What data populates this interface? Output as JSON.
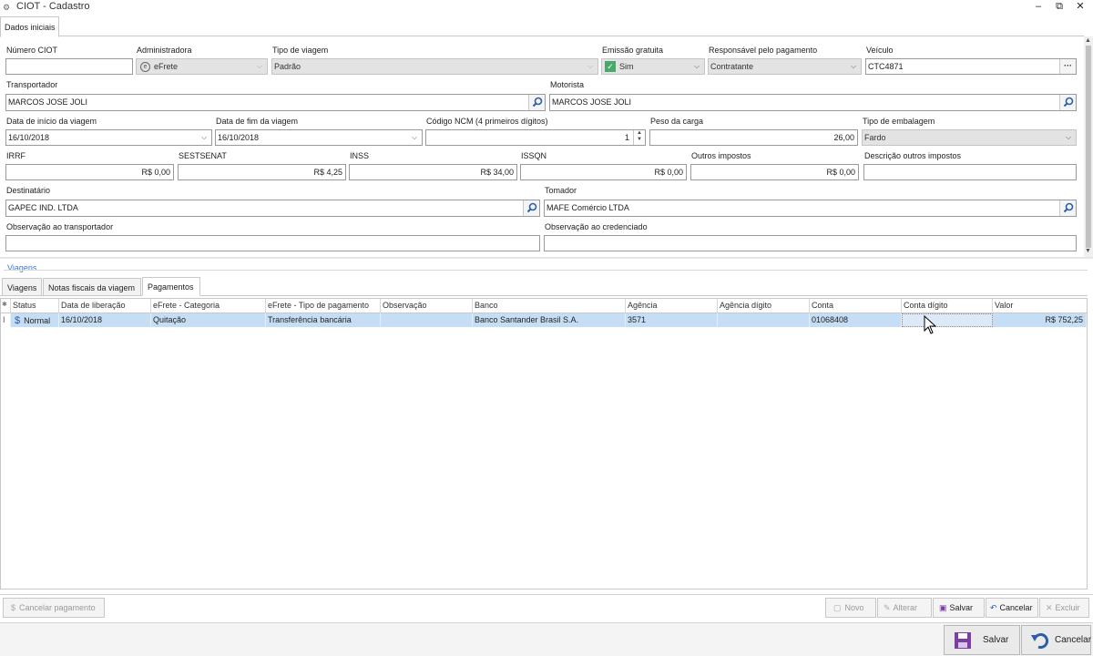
{
  "window": {
    "title": "CIOT - Cadastro",
    "minimize": "‒",
    "restore": "⧉",
    "close": "✕"
  },
  "tabs": {
    "main": "Dados iniciais"
  },
  "form": {
    "numero_ciot": {
      "label": "Número CIOT",
      "value": ""
    },
    "administradora": {
      "label": "Administradora",
      "value": "eFrete"
    },
    "tipo_viagem": {
      "label": "Tipo de viagem",
      "value": "Padrão"
    },
    "emissao_gratuita": {
      "label": "Emissão gratuita",
      "value": "Sim"
    },
    "responsavel": {
      "label": "Responsável pelo pagamento",
      "value": "Contratante"
    },
    "veiculo": {
      "label": "Veículo",
      "value": "CTC4871",
      "btn": "···"
    },
    "transportador": {
      "label": "Transportador",
      "value": "MARCOS JOSE JOLI"
    },
    "motorista": {
      "label": "Motorista",
      "value": "MARCOS JOSE JOLI"
    },
    "data_inicio": {
      "label": "Data de início da viagem",
      "value": "16/10/2018"
    },
    "data_fim": {
      "label": "Data de fim da viagem",
      "value": "16/10/2018"
    },
    "ncm": {
      "label": "Código NCM (4 primeiros dígitos)",
      "value": "1"
    },
    "peso": {
      "label": "Peso da carga",
      "value": "26,00"
    },
    "embalagem": {
      "label": "Tipo de embalagem",
      "value": "Fardo"
    },
    "irrf": {
      "label": "IRRF",
      "value": "R$ 0,00"
    },
    "sestsenat": {
      "label": "SESTSENAT",
      "value": "R$ 4,25"
    },
    "inss": {
      "label": "INSS",
      "value": "R$ 34,00"
    },
    "issqn": {
      "label": "ISSQN",
      "value": "R$ 0,00"
    },
    "outros": {
      "label": "Outros impostos",
      "value": "R$ 0,00"
    },
    "desc_outros": {
      "label": "Descrição outros impostos",
      "value": ""
    },
    "destinatario": {
      "label": "Destinatário",
      "value": "GAPEC IND. LTDA"
    },
    "tomador": {
      "label": "Tomador",
      "value": "MAFE Comércio LTDA"
    },
    "obs_transportador": {
      "label": "Observação ao transportador",
      "value": ""
    },
    "obs_credenciado": {
      "label": "Observação ao credenciado",
      "value": ""
    }
  },
  "viagens": {
    "group_title": "Viagens",
    "tabs": [
      "Viagens",
      "Notas fiscais da viagem",
      "Pagamentos"
    ],
    "columns": [
      "Status",
      "Data de liberação",
      "eFrete - Categoria",
      "eFrete - Tipo de pagamento",
      "Observação",
      "Banco",
      "Agência",
      "Agência dígito",
      "Conta",
      "Conta dígito",
      "Valor"
    ],
    "row_marker": "I",
    "rows": [
      {
        "status_icon": "$",
        "status": "Normal",
        "data": "16/10/2018",
        "categoria": "Quitação",
        "tipo": "Transferência bancária",
        "obs": "",
        "banco": "Banco Santander Brasil S.A.",
        "agencia": "3571",
        "ag_digito": "",
        "conta": "01068408",
        "conta_digito": "",
        "valor": "R$ 752,25"
      }
    ]
  },
  "toolbar": {
    "cancelar_pagamento": "Cancelar pagamento",
    "novo": "Novo",
    "alterar": "Alterar",
    "salvar": "Salvar",
    "cancelar": "Cancelar",
    "excluir": "Excluir"
  },
  "footer": {
    "salvar": "Salvar",
    "cancelar": "Cancelar"
  },
  "colors": {
    "selected_row": "#c5def5",
    "link_blue": "#3c78c8",
    "save_icon": "#7a3fa0",
    "cancel_icon": "#2a5ea8"
  }
}
